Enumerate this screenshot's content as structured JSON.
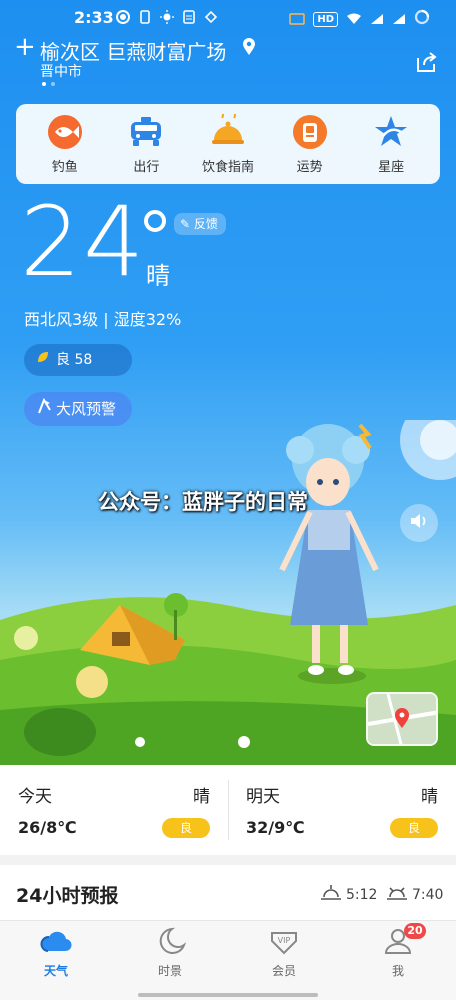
{
  "status_bar": {
    "time": "2:33",
    "hd": "HD",
    "signal1": "4G",
    "signal2": "4G"
  },
  "location": {
    "district": "榆次区 巨燕财富广场",
    "city": "晋中市"
  },
  "quick_menu": [
    {
      "label": "钓鱼",
      "icon": "fish-icon"
    },
    {
      "label": "出行",
      "icon": "taxi-icon"
    },
    {
      "label": "饮食指南",
      "icon": "food-cloche-icon"
    },
    {
      "label": "运势",
      "icon": "fortune-icon"
    },
    {
      "label": "星座",
      "icon": "star-icon"
    }
  ],
  "current": {
    "temperature": "24",
    "condition": "晴",
    "feedback_label": "反馈",
    "wind_humidity": "西北风3级 | 湿度32%",
    "aqi_label": "良 58",
    "warning_label": "大风预警"
  },
  "watermark": "公众号：蓝胖子的日常",
  "days": [
    {
      "name": "今天",
      "condition": "晴",
      "range": "26/8℃",
      "quality": "良"
    },
    {
      "name": "明天",
      "condition": "晴",
      "range": "32/9℃",
      "quality": "良"
    }
  ],
  "forecast": {
    "title": "24小时预报",
    "sunrise": "5:12",
    "sunset": "7:40"
  },
  "tabs": [
    {
      "label": "天气",
      "icon": "cloud-icon"
    },
    {
      "label": "时景",
      "icon": "moon-icon"
    },
    {
      "label": "会员",
      "icon": "vip-icon"
    },
    {
      "label": "我",
      "icon": "user-icon",
      "badge": "20"
    }
  ],
  "colors": {
    "accent": "#1c7ce4",
    "sky": "#1d8ff0",
    "quality_badge": "#f7c21a",
    "badge": "#f04848"
  }
}
